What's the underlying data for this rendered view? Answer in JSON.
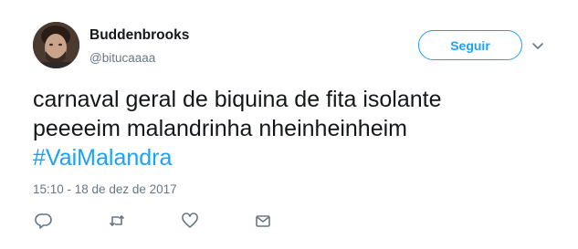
{
  "author": {
    "name": "Buddenbrooks",
    "handle": "@bitucaaaa"
  },
  "follow_button": {
    "label": "Seguir"
  },
  "tweet": {
    "lines": [
      "carnaval geral de biquina de fita isolante",
      "peeeeim malandrinha nheinheinheim"
    ],
    "hashtag": "#VaiMalandra",
    "timestamp": "15:10 - 18 de dez de 2017"
  },
  "icons": {
    "caret": "chevron-down-icon",
    "reply": "reply-icon",
    "retweet": "retweet-icon",
    "like": "heart-icon",
    "message": "envelope-icon"
  },
  "colors": {
    "accent": "#1da1f2",
    "text": "#14171a",
    "muted": "#657786"
  }
}
